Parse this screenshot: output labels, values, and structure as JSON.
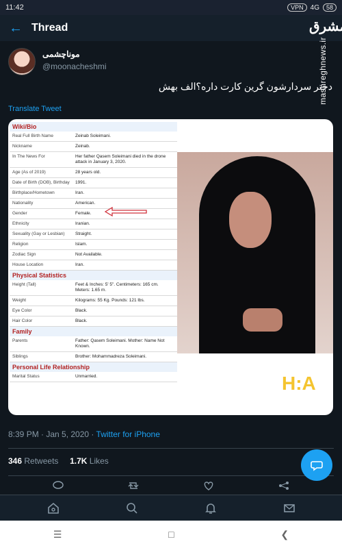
{
  "status": {
    "time": "11:42",
    "network": "4G",
    "battery": "58",
    "badge": "VPN"
  },
  "header": {
    "title": "Thread"
  },
  "watermark": {
    "logo": "مشرق",
    "site": "mashreghnews.ir"
  },
  "tweet": {
    "name": "موناچشمی",
    "handle": "@moonacheshmi",
    "text": "دختر سردارشون گرین کارت داره؟الف بهش",
    "translate": "Translate Tweet",
    "timestamp": "8:39 PM · Jan 5, 2020 · ",
    "source": "Twitter for iPhone",
    "retweets": "346",
    "retweets_label": "Retweets",
    "likes": "1.7K",
    "likes_label": "Likes"
  },
  "bio": {
    "header": "Wiki/Bio",
    "rows": [
      [
        "Real Full Birth Name",
        "Zeinab Soleimani."
      ],
      [
        "Nickname",
        "Zeinab."
      ],
      [
        "In The News For",
        "Her father Qasem Soleimani died in the drone attack in January 3, 2020."
      ],
      [
        "Age (As of 2019)",
        "28 years old."
      ],
      [
        "Date of Birth (DOB), Birthday",
        "1991."
      ],
      [
        "Birthplace/Hometown",
        "Iran."
      ],
      [
        "Nationality",
        "American."
      ],
      [
        "Gender",
        "Female."
      ],
      [
        "Ethnicity",
        "Iranian."
      ],
      [
        "Sexuality (Gay or Lesbian)",
        "Straight."
      ],
      [
        "Religion",
        "Islam."
      ],
      [
        "Zodiac Sign",
        "Not Available."
      ],
      [
        "House Location",
        "Iran."
      ]
    ],
    "physical_header": "Physical Statistics",
    "physical": [
      [
        "Height (Tall)",
        "Feet & Inches: 5' 5\". Centimeters: 165 cm. Meters: 1.65 m."
      ],
      [
        "Weight",
        "Kilograms: 55 Kg. Pounds: 121 lbs."
      ],
      [
        "Eye Color",
        "Black."
      ],
      [
        "Hair Color",
        "Black."
      ]
    ],
    "family_header": "Family",
    "family": [
      [
        "Parents",
        "Father: Qasem Soleimani. Mother: Name Not Known."
      ],
      [
        "Siblings",
        "Brother: Mohammadreza Soleimani."
      ]
    ],
    "personal_header": "Personal Life Relationship",
    "personal": [
      [
        "Marital Status",
        "Unmarried."
      ]
    ]
  },
  "photo_mark": "H:A",
  "colors": {
    "accent": "#1da1f2",
    "bg": "#10171e",
    "bio_header": "#b22222",
    "mark": "#f4c430"
  }
}
